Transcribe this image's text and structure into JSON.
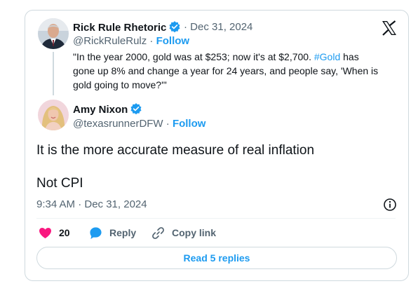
{
  "quoted_tweet": {
    "author_name": "Rick Rule Rhetoric",
    "separator_date": "· Dec 31, 2024",
    "handle": "@RickRuleRulz",
    "follow_separator": "·",
    "follow_label": "Follow",
    "text_part1": "\"In the year 2000, gold was at $253; now it's at $2,700. ",
    "hashtag": "#Gold",
    "text_part2": " has gone up 8% and change a year for 24 years, and people say, 'When is gold going to move?'\""
  },
  "main_tweet": {
    "author_name": "Amy Nixon",
    "handle": "@texasrunnerDFW",
    "follow_separator": "·",
    "follow_label": "Follow",
    "body_line1": "It is the more accurate measure of real inflation",
    "body_line2": "Not CPI",
    "timestamp": "9:34 AM · Dec 31, 2024"
  },
  "actions": {
    "like_count": "20",
    "reply_label": "Reply",
    "copy_link_label": "Copy link"
  },
  "read_replies_label": "Read 5 replies",
  "icons": {
    "brand": "x-logo-icon",
    "verified": "verified-badge-icon",
    "like": "heart-icon",
    "reply": "speech-bubble-icon",
    "copy_link": "link-icon",
    "info": "info-icon"
  },
  "colors": {
    "accent": "#1d9bf0",
    "like": "#f91880",
    "text": "#0f1419",
    "muted": "#536471",
    "border": "#cfd9de"
  }
}
